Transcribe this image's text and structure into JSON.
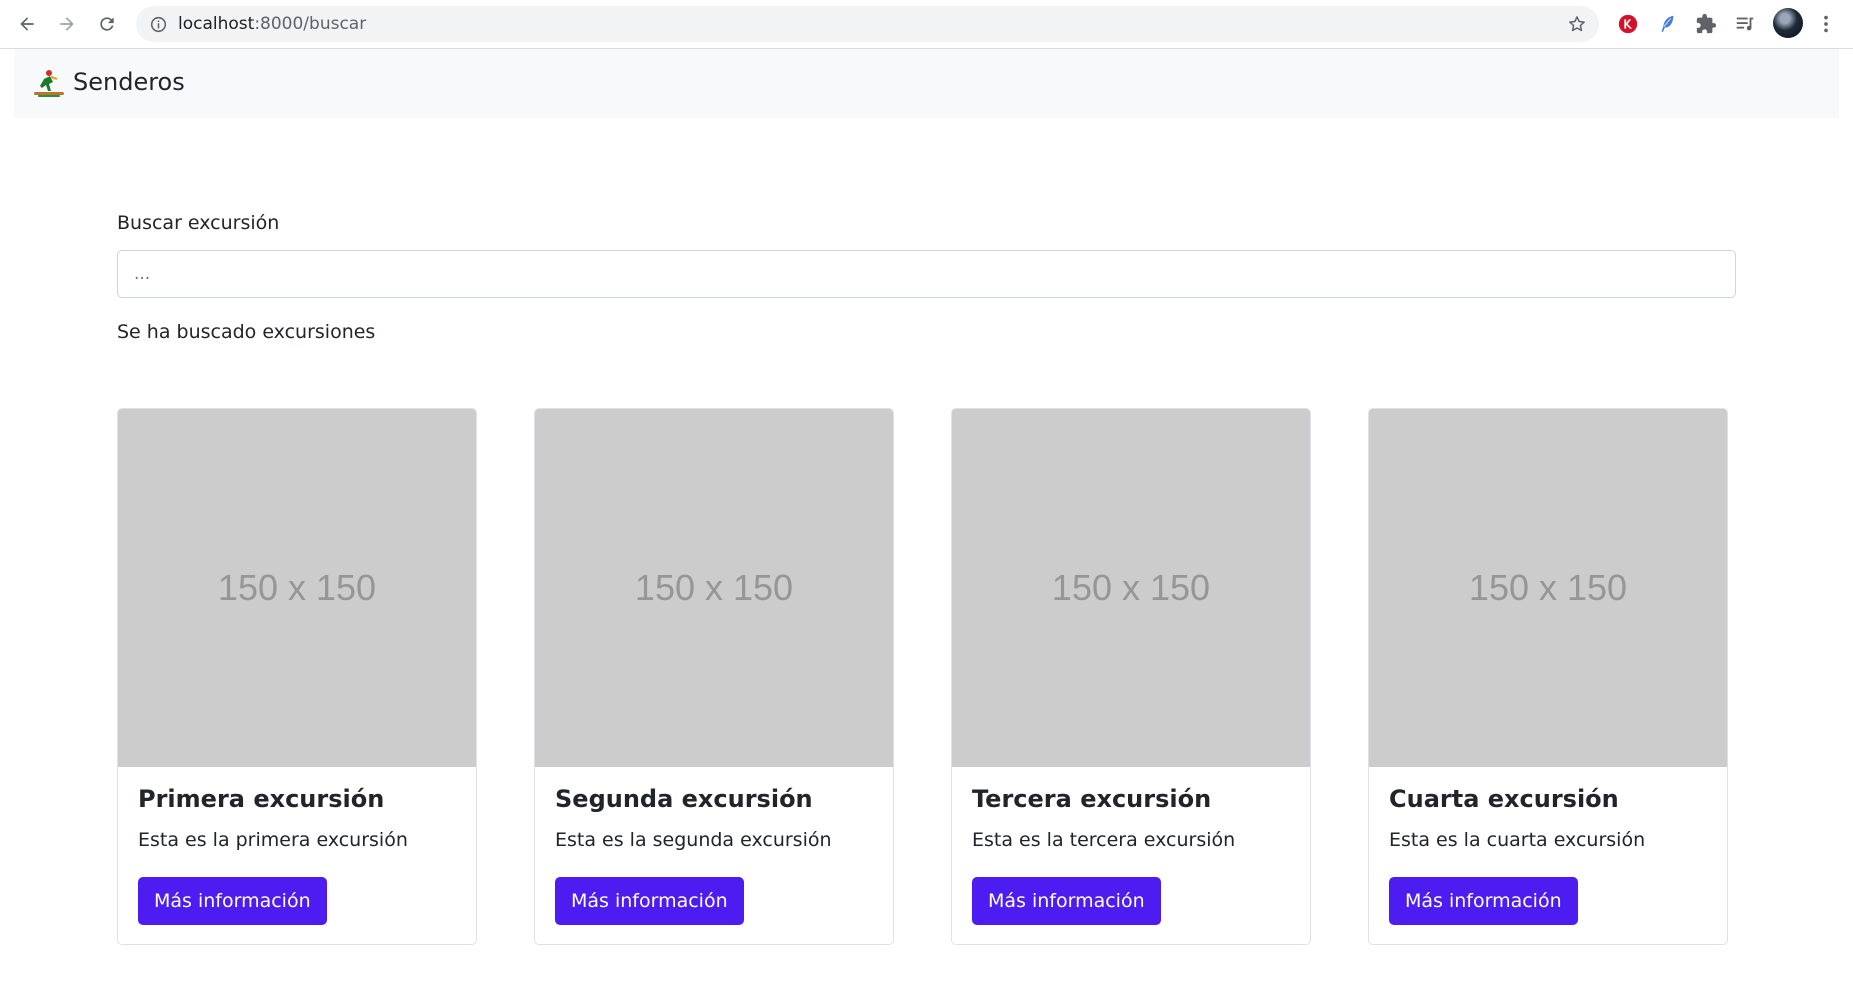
{
  "browser": {
    "url_host": "localhost",
    "url_path": ":8000/buscar"
  },
  "navbar": {
    "brand": "Senderos"
  },
  "search": {
    "label": "Buscar excursión",
    "placeholder": "..."
  },
  "result_text": "Se ha buscado excursiones",
  "cards": [
    {
      "image_text": "150 x 150",
      "title": "Primera excursión",
      "text": "Esta es la primera excursión",
      "button": "Más información"
    },
    {
      "image_text": "150 x 150",
      "title": "Segunda excursión",
      "text": "Esta es la segunda excursión",
      "button": "Más información"
    },
    {
      "image_text": "150 x 150",
      "title": "Tercera excursión",
      "text": "Esta es la tercera excursión",
      "button": "Más información"
    },
    {
      "image_text": "150 x 150",
      "title": "Cuarta excursión",
      "text": "Esta es la cuarta excursión",
      "button": "Más información"
    }
  ],
  "colors": {
    "primary_button": "#4c1cf1",
    "placeholder_image": "#cccccc",
    "navbar_bg": "#f8f9fa"
  }
}
